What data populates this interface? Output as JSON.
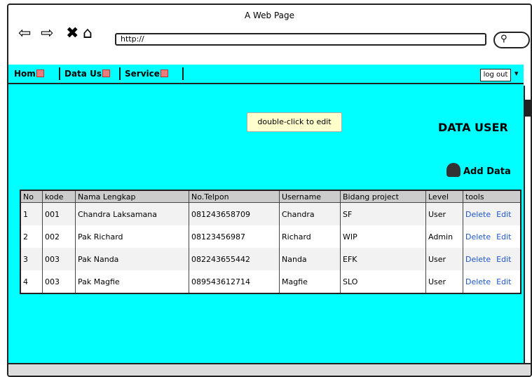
{
  "window": {
    "title": "A Web Page"
  },
  "toolbar": {
    "url_value": "http://"
  },
  "nav": {
    "items": [
      {
        "label": "Hom"
      },
      {
        "label": "Data Us"
      },
      {
        "label": "Service"
      }
    ]
  },
  "session": {
    "logout_label": "log out"
  },
  "tooltip": "double-click to edit",
  "page": {
    "title": "DATA USER",
    "add_label": "Add Data"
  },
  "table": {
    "headers": [
      "No",
      "kode",
      "Nama Lengkap",
      "No.Telpon",
      "Username",
      "Bidang project",
      "Level",
      "tools"
    ],
    "rows": [
      {
        "no": "1",
        "kode": "001",
        "nama": "Chandra Laksamana",
        "telp": "081243658709",
        "username": "Chandra",
        "bidang": "SF",
        "level": "User",
        "delete": "Delete",
        "edit": "Edit"
      },
      {
        "no": "2",
        "kode": "002",
        "nama": "Pak Richard",
        "telp": "08123456987",
        "username": "Richard",
        "bidang": "WIP",
        "level": "Admin",
        "delete": "Delete",
        "edit": "Edit"
      },
      {
        "no": "3",
        "kode": "003",
        "nama": "Pak Nanda",
        "telp": "082243655442",
        "username": "Nanda",
        "bidang": "EFK",
        "level": "User",
        "delete": "Delete",
        "edit": "Edit"
      },
      {
        "no": "4",
        "kode": "003",
        "nama": "Pak Magfie",
        "telp": "089543612714",
        "username": "Magfie",
        "bidang": "SLO",
        "level": "User",
        "delete": "Delete",
        "edit": "Edit"
      }
    ]
  },
  "colors": {
    "content_bg": "#00ffff",
    "link": "#1e56c7",
    "header_bg": "#cccccc"
  },
  "icons": [
    "back-arrow-icon",
    "forward-arrow-icon",
    "stop-icon",
    "home-icon",
    "search-icon",
    "user-add-icon",
    "link-marker-icon",
    "scroll-up-icon"
  ]
}
